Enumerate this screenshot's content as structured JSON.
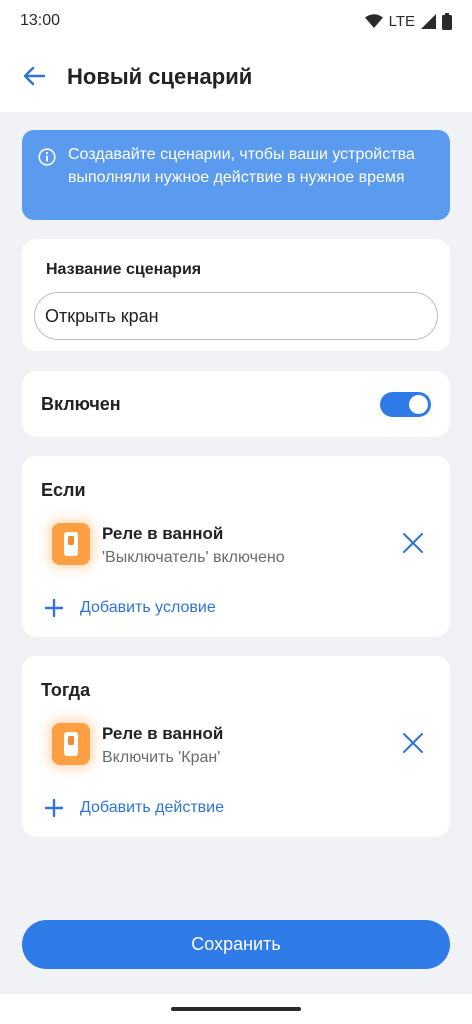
{
  "status_bar": {
    "time": "13:00",
    "network": "LTE",
    "icons": [
      "wifi-icon",
      "cellular-signal-icon",
      "battery-icon"
    ]
  },
  "app_bar": {
    "back_icon": "arrow-left-icon",
    "title": "Новый сценарий"
  },
  "info_banner": {
    "icon": "info-icon",
    "text": "Создавайте сценарии, чтобы ваши устройства выполняли нужное действие в нужное время"
  },
  "name_card": {
    "label": "Название сценария",
    "value": "Открыть кран"
  },
  "toggle_card": {
    "label": "Включен",
    "enabled": true
  },
  "if_card": {
    "title": "Если",
    "items": [
      {
        "icon": "relay-switch-icon",
        "title": "Реле в ванной",
        "subtitle": "'Выключатель' включено"
      }
    ],
    "add_label": "Добавить условие"
  },
  "then_card": {
    "title": "Тогда",
    "items": [
      {
        "icon": "relay-switch-icon",
        "title": "Реле в ванной",
        "subtitle": "Включить 'Кран'"
      }
    ],
    "add_label": "Добавить действие"
  },
  "save_button": {
    "label": "Сохранить"
  },
  "colors": {
    "accent": "#2f7be8",
    "banner": "#5b9bef",
    "device": "#ff9f43",
    "background": "#f1f2f6"
  }
}
